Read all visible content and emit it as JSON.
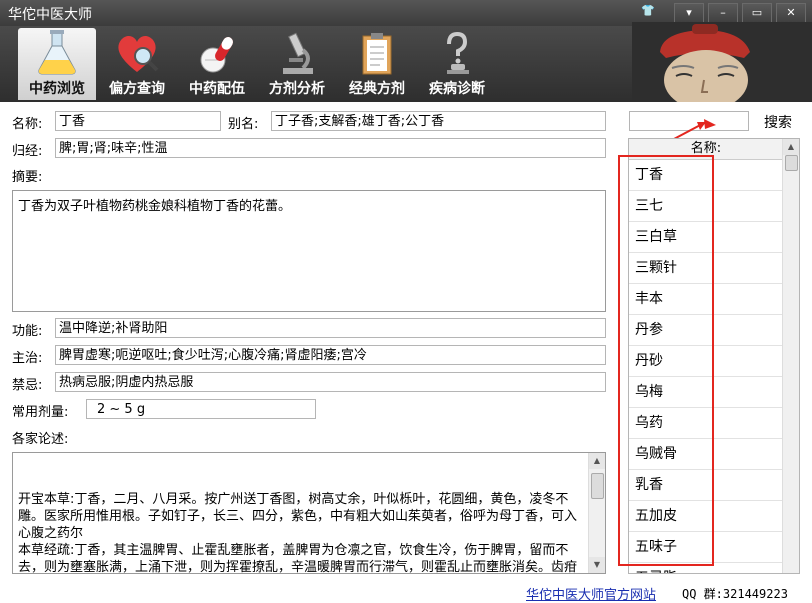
{
  "window": {
    "title": "华佗中医大师",
    "controls": [
      "▾",
      "–",
      "▭",
      "✕"
    ]
  },
  "toolbar": [
    {
      "label": "中药浏览",
      "icon": "flask-icon",
      "active": true
    },
    {
      "label": "偏方查询",
      "icon": "heart-magnifier-icon",
      "active": false
    },
    {
      "label": "中药配伍",
      "icon": "pills-icon",
      "active": false
    },
    {
      "label": "方剂分析",
      "icon": "microscope-icon",
      "active": false
    },
    {
      "label": "经典方剂",
      "icon": "clipboard-icon",
      "active": false
    },
    {
      "label": "疾病诊断",
      "icon": "question-figure-icon",
      "active": false
    }
  ],
  "form": {
    "name_label": "名称:",
    "name_value": "丁香",
    "alias_label": "别名:",
    "alias_value": "丁子香;支解香;雄丁香;公丁香",
    "meridian_label": "归经:",
    "meridian_value": "脾;胃;肾;味辛;性温",
    "summary_label": "摘要:",
    "summary_value": "丁香为双子叶植物药桃金娘科植物丁香的花蕾。",
    "function_label": "功能:",
    "function_value": "温中降逆;补肾助阳",
    "indication_label": "主治:",
    "indication_value": "脾胃虚寒;呃逆呕吐;食少吐泻;心腹冷痛;肾虚阳痿;宫冷",
    "taboo_label": "禁忌:",
    "taboo_value": "热病忌服;阴虚内热忌服",
    "dosage_label": "常用剂量:",
    "dosage_value": "2 ~ 5 g",
    "commentary_label": "各家论述:",
    "commentary_value": "开宝本草:丁香，二月、八月采。按广州送丁香图，树高丈余，叶似栎叶，花圆细，黄色，凌冬不雕。医家所用惟用根。子如钉子，长三、四分，紫色，中有粗大如山茱萸者，俗呼为母丁香，可入心腹之药尔\n本草经疏:丁香，其主温脾胃、止霍乱壅胀者，盖脾胃为仓凛之官，饮食生冷，伤于脾胃，留而不去，则为壅塞胀满，上涌下泄，则为挥霍撩乱，辛温暖脾胃而行滞气，则霍乱止而壅胀消矣。齿疳者，亦阳明湿热上攻也，散阳明之邪，则疳自除。疗风毒诸肿者，辛温散结，而香气又能走窍除秽浊也"
  },
  "search": {
    "input_value": "",
    "button_label": "搜索"
  },
  "herb_list": {
    "header": "名称:",
    "items": [
      "丁香",
      "三七",
      "三白草",
      "三颗针",
      "丰本",
      "丹参",
      "丹砂",
      "乌梅",
      "乌药",
      "乌贼骨",
      "乳香",
      "五加皮",
      "五味子",
      "五灵脂"
    ]
  },
  "footer": {
    "site_link": "华佗中医大师官方网站",
    "qq_text": "QQ 群:321449223"
  },
  "colors": {
    "annotation_red": "#e3261f",
    "toolbar_dark": "#2e2e2e",
    "link_blue": "#1a2fb0"
  }
}
